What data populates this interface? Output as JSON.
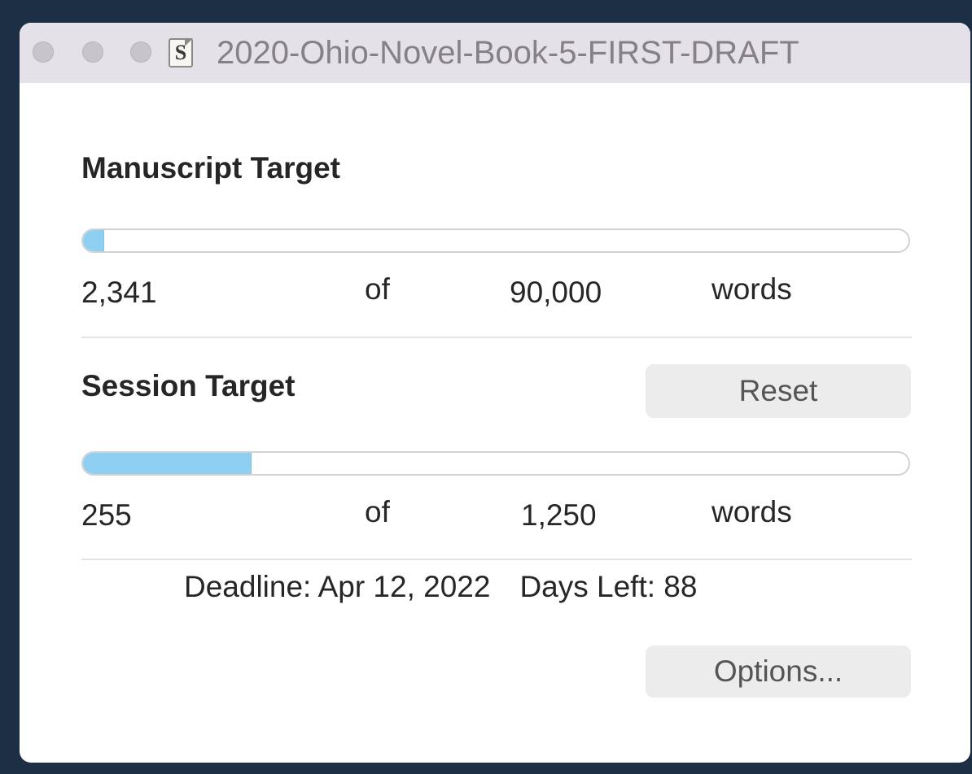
{
  "window": {
    "title": "2020-Ohio-Novel-Book-5-FIRST-DRAFT",
    "icon": "scrivener-document-icon"
  },
  "manuscript": {
    "heading": "Manuscript Target",
    "current": "2,341",
    "of_label": "of",
    "target": "90,000",
    "unit": "words",
    "progress_fraction": 0.026
  },
  "session": {
    "heading": "Session Target",
    "reset_label": "Reset",
    "current": "255",
    "of_label": "of",
    "target": "1,250",
    "unit": "words",
    "progress_fraction": 0.204
  },
  "deadline": {
    "deadline_text": "Deadline: Apr 12, 2022",
    "days_left_text": "Days Left: 88"
  },
  "options_label": "Options...",
  "colors": {
    "progress_fill": "#8fd0f2",
    "titlebar": "#e5e1e8",
    "desktop_background": "#1c2f45"
  }
}
